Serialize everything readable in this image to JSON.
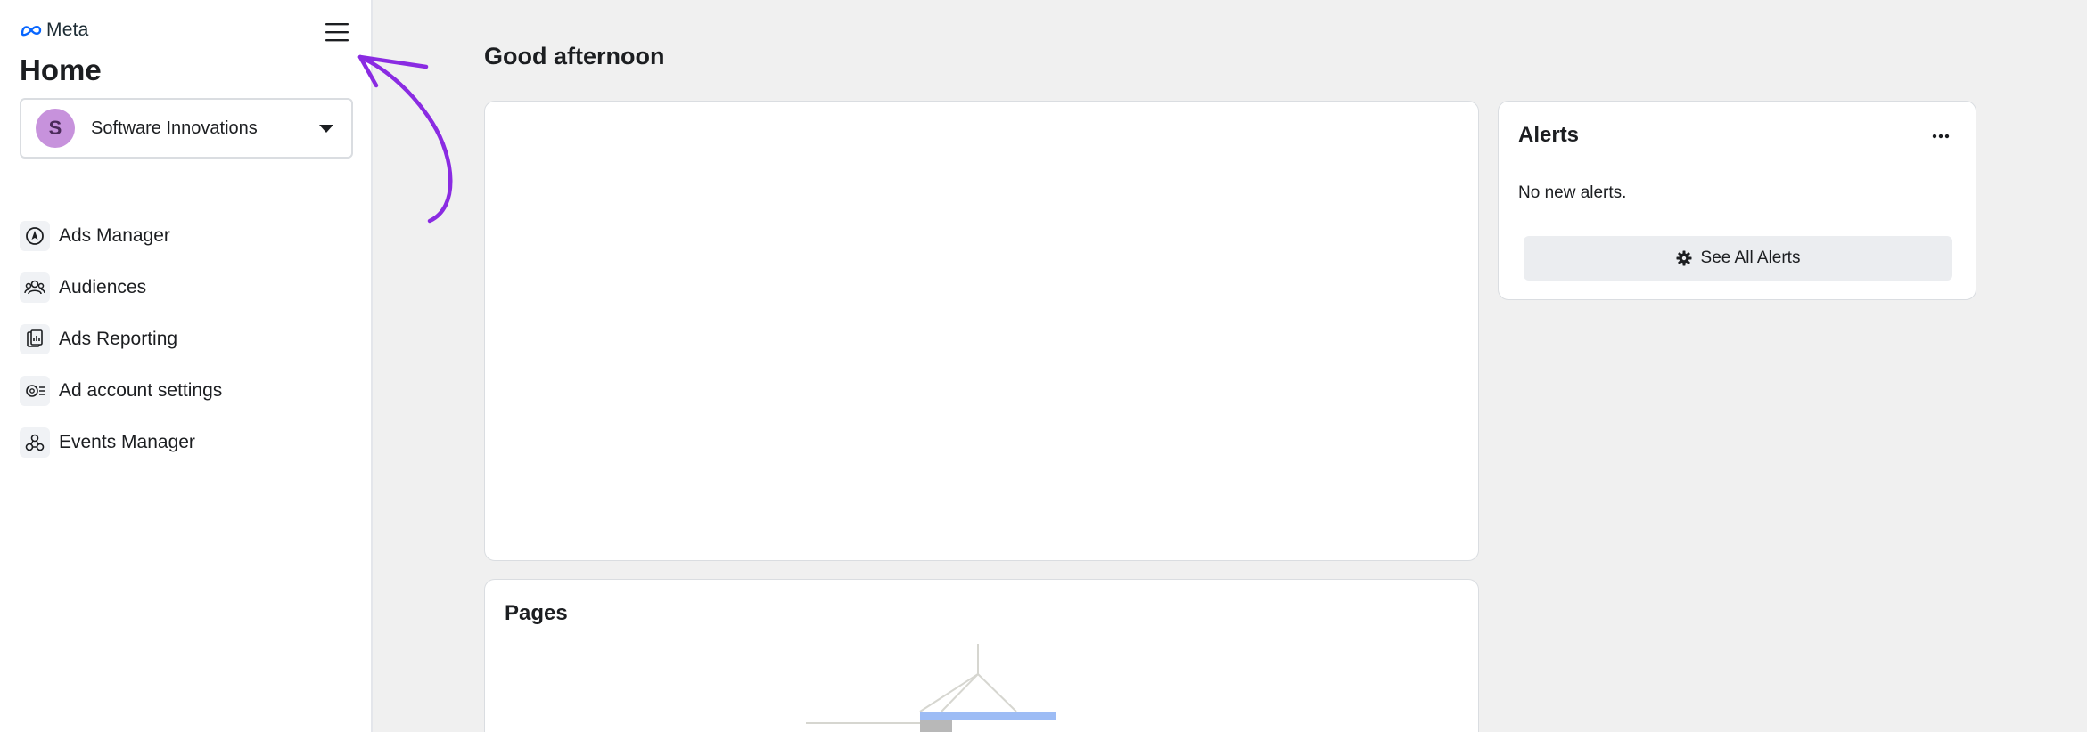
{
  "brand": {
    "name": "Meta"
  },
  "sidebar": {
    "title": "Home",
    "account": {
      "initial": "S",
      "name": "Software Innovations"
    },
    "items": [
      {
        "label": "Ads Manager",
        "icon": "compass-icon"
      },
      {
        "label": "Audiences",
        "icon": "people-icon"
      },
      {
        "label": "Ads Reporting",
        "icon": "report-icon"
      },
      {
        "label": "Ad account settings",
        "icon": "settings-icon"
      },
      {
        "label": "Events Manager",
        "icon": "events-icon"
      }
    ]
  },
  "main": {
    "greeting": "Good afternoon",
    "pages_card": {
      "title": "Pages"
    },
    "alerts_card": {
      "title": "Alerts",
      "empty_message": "No new alerts.",
      "see_all_label": "See All Alerts"
    }
  },
  "colors": {
    "annotation": "#8a2be2",
    "avatar": "#c792dc",
    "accent": "#0866ff"
  }
}
